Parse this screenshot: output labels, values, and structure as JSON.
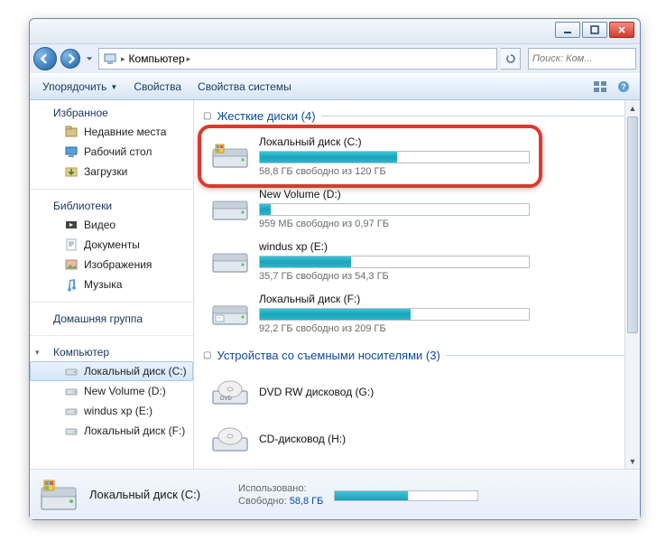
{
  "address": {
    "location": "Компьютер"
  },
  "search": {
    "placeholder": "Поиск: Ком..."
  },
  "toolbar": {
    "organize": "Упорядочить",
    "properties": "Свойства",
    "system_properties": "Свойства системы"
  },
  "sidebar": {
    "favorites": {
      "label": "Избранное",
      "items": [
        "Недавние места",
        "Рабочий стол",
        "Загрузки"
      ]
    },
    "libraries": {
      "label": "Библиотеки",
      "items": [
        "Видео",
        "Документы",
        "Изображения",
        "Музыка"
      ]
    },
    "homegroup": {
      "label": "Домашняя группа"
    },
    "computer": {
      "label": "Компьютер",
      "items": [
        "Локальный диск (C:)",
        "New Volume (D:)",
        "windus xp (E:)",
        "Локальный диск (F:)"
      ]
    }
  },
  "main": {
    "group_hdd": "Жесткие диски (4)",
    "group_removable": "Устройства со съемными носителями (3)",
    "drives": [
      {
        "name": "Локальный диск (C:)",
        "info": "58,8 ГБ свободно из 120 ГБ",
        "fill_pct": 51,
        "highlight": true
      },
      {
        "name": "New Volume (D:)",
        "info": "959 МБ свободно из 0,97 ГБ",
        "fill_pct": 4
      },
      {
        "name": "windus xp (E:)",
        "info": "35,7 ГБ свободно из 54,3 ГБ",
        "fill_pct": 34
      },
      {
        "name": "Локальный диск (F:)",
        "info": "92,2 ГБ свободно из 209 ГБ",
        "fill_pct": 56
      }
    ],
    "opticals": [
      {
        "name": "DVD RW дисковод (G:)"
      },
      {
        "name": "CD-дисковод (H:)"
      }
    ]
  },
  "details": {
    "name": "Локальный диск (C:)",
    "used_label": "Использовано:",
    "free_label": "Свободно:",
    "free_value": "58,8 ГБ",
    "fill_pct": 51
  }
}
